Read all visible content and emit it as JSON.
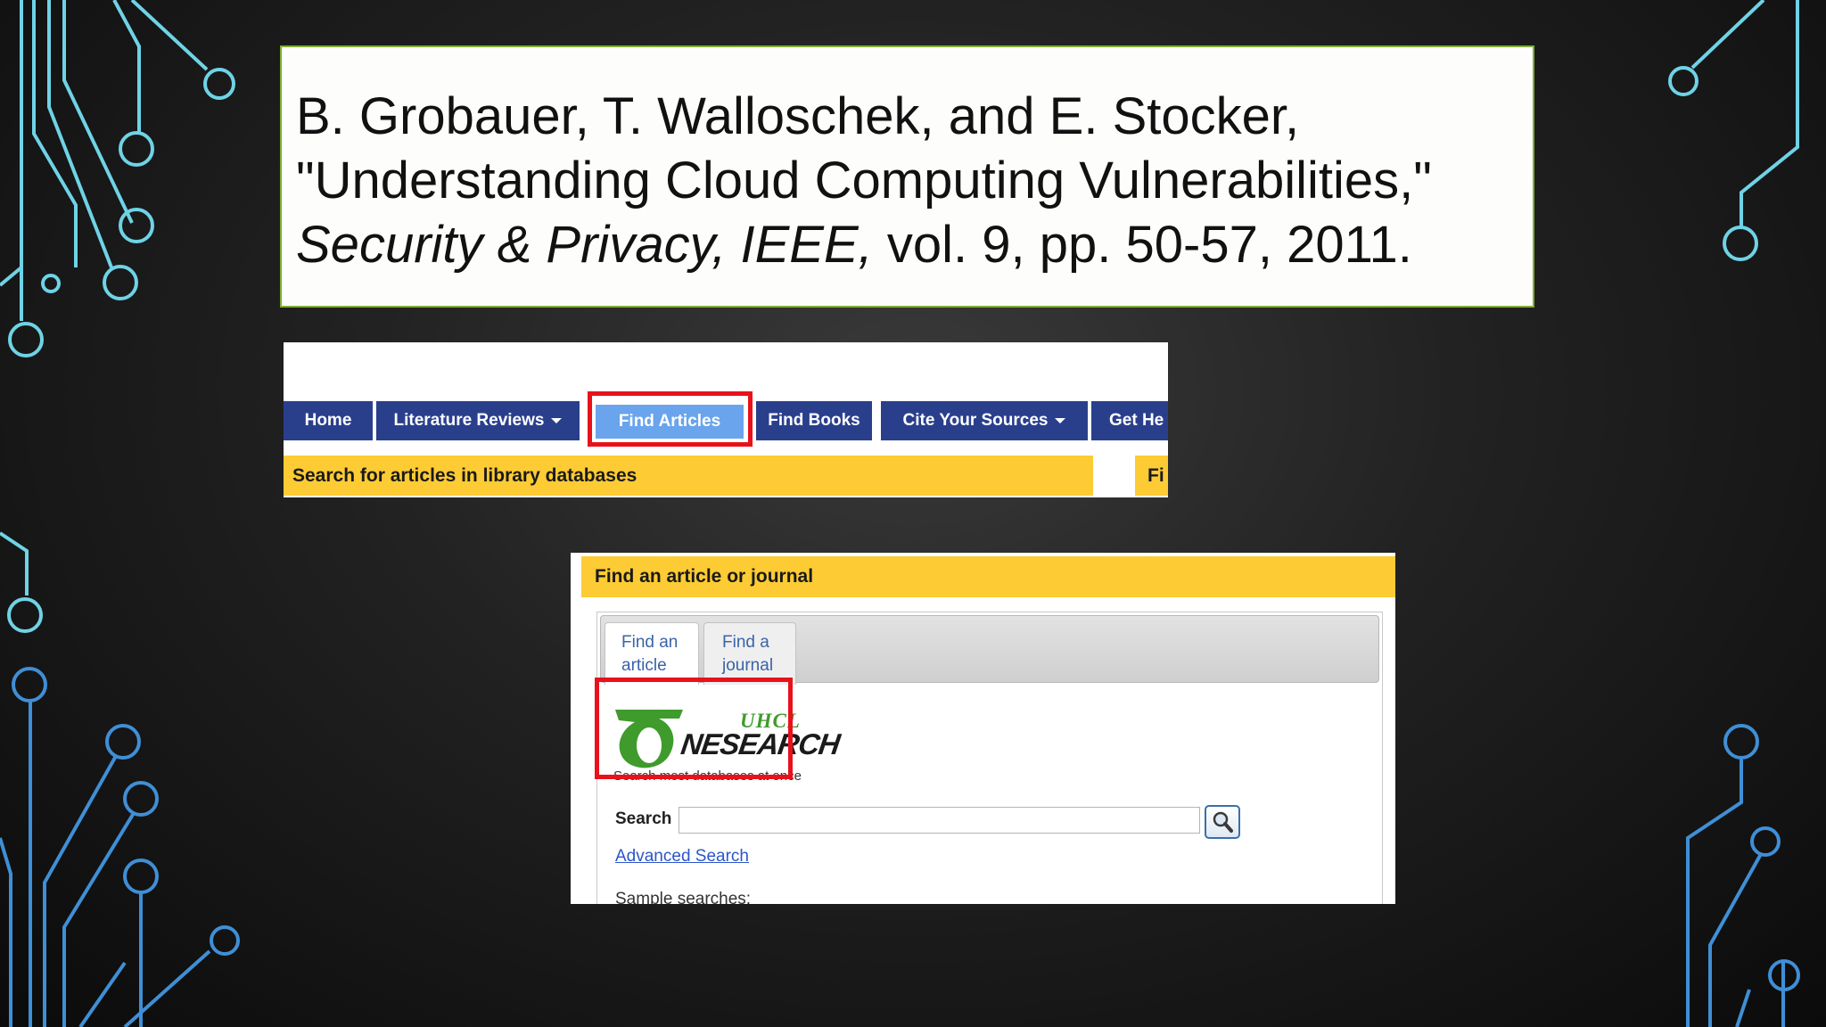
{
  "citation": {
    "line1": "B. Grobauer, T. Walloschek, and E. Stocker,",
    "line2": "\"Understanding Cloud Computing Vulnerabilities,\"",
    "journal": "Security & Privacy, IEEE,",
    "details": " vol. 9, pp. 50-57, 2011."
  },
  "nav": {
    "tabs": [
      "Home",
      "Literature Reviews",
      "Find Articles",
      "Find Books",
      "Cite Your Sources",
      "Get He"
    ],
    "active_tab": "Find Articles",
    "subbar_text": "Search for articles in library databases",
    "subbar_right_text": "Fi"
  },
  "article_panel": {
    "header": "Find an article or journal",
    "tab_article": "Find an article",
    "tab_journal": "Find a journal",
    "logo_text_top": "UHCL",
    "logo_text_main": "NESEARCH",
    "tagline": "Search most databases at once",
    "search_label": "Search",
    "search_value": "",
    "advanced_link": "Advanced Search",
    "sample_text": "Sample searches:"
  },
  "colors": {
    "nav_tab": "#2a3f8c",
    "nav_tab_active": "#6aa4ec",
    "highlight": "#e8121b",
    "yellow_bar": "#fdcb34",
    "citation_border": "#7fae34",
    "circuit_cyan": "#6fd3e6",
    "circuit_blue": "#3f8fd6",
    "logo_green": "#3f9b2c"
  },
  "icons": [
    "search-icon",
    "caret-down-icon",
    "onesearch-logo",
    "circuit-decoration"
  ]
}
